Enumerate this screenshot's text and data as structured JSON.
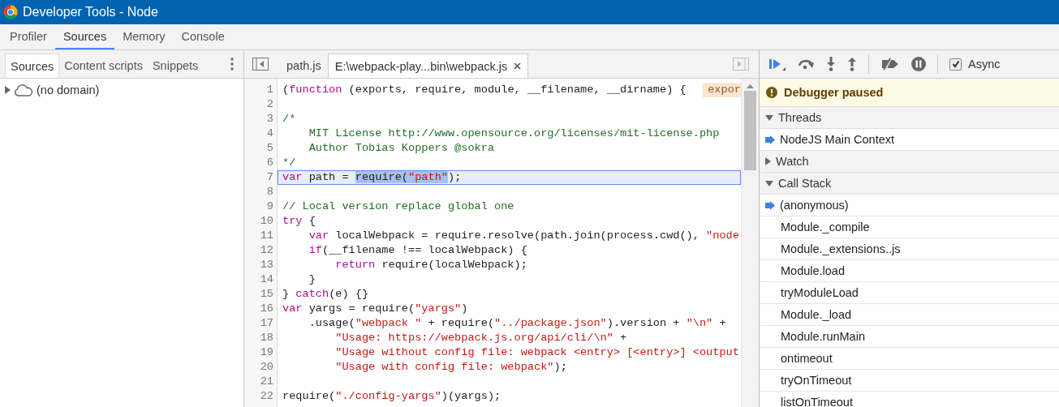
{
  "window": {
    "title": "Developer Tools - Node"
  },
  "main_tabs": [
    {
      "label": "Profiler",
      "selected": false
    },
    {
      "label": "Sources",
      "selected": true
    },
    {
      "label": "Memory",
      "selected": false
    },
    {
      "label": "Console",
      "selected": false
    }
  ],
  "navigator": {
    "tabs": [
      {
        "label": "Sources",
        "selected": true
      },
      {
        "label": "Content scripts",
        "selected": false
      },
      {
        "label": "Snippets",
        "selected": false
      }
    ],
    "tree": [
      {
        "label": "(no domain)",
        "expanded": false
      }
    ]
  },
  "editor": {
    "tabs": [
      {
        "label": "path.js",
        "selected": false,
        "closable": false
      },
      {
        "label": "E:\\webpack-play...bin\\webpack.js",
        "selected": true,
        "closable": true
      }
    ],
    "inline_value": "expor",
    "lines": [
      {
        "number": "1",
        "current": false,
        "tokens": [
          {
            "kind": "plain",
            "text": "("
          },
          {
            "kind": "keyword",
            "text": "function"
          },
          {
            "kind": "plain",
            "text": " (exports, require, module, __filename, __dirname) {"
          }
        ]
      },
      {
        "number": "2",
        "current": false
      },
      {
        "number": "3",
        "current": false,
        "tokens": [
          {
            "kind": "comment",
            "text": "/*"
          }
        ]
      },
      {
        "number": "4",
        "current": false,
        "tokens": [
          {
            "kind": "comment",
            "text": "    MIT License http://www.opensource.org/licenses/mit-license.php"
          }
        ]
      },
      {
        "number": "5",
        "current": false,
        "tokens": [
          {
            "kind": "comment",
            "text": "    Author Tobias Koppers @sokra"
          }
        ]
      },
      {
        "number": "6",
        "current": false,
        "tokens": [
          {
            "kind": "comment",
            "text": "*/"
          }
        ]
      },
      {
        "number": "7",
        "current": true,
        "tokens": [
          {
            "kind": "keyword",
            "text": "var"
          },
          {
            "kind": "plain",
            "text": " path = "
          },
          {
            "kind": "selection",
            "tokens": [
              {
                "kind": "plain",
                "text": "require("
              },
              {
                "kind": "string",
                "text": "\"path\""
              }
            ]
          },
          {
            "kind": "plain",
            "text": ");"
          }
        ]
      },
      {
        "number": "8",
        "current": false
      },
      {
        "number": "9",
        "current": false,
        "tokens": [
          {
            "kind": "comment",
            "text": "// Local version replace global one"
          }
        ]
      },
      {
        "number": "10",
        "current": false,
        "tokens": [
          {
            "kind": "keyword",
            "text": "try"
          },
          {
            "kind": "plain",
            "text": " {"
          }
        ]
      },
      {
        "number": "11",
        "current": false,
        "tokens": [
          {
            "kind": "keyword",
            "text": "    var"
          },
          {
            "kind": "plain",
            "text": " localWebpack = require.resolve(path.join(process.cwd(), "
          },
          {
            "kind": "string",
            "text": "\"node"
          }
        ]
      },
      {
        "number": "12",
        "current": false,
        "tokens": [
          {
            "kind": "keyword",
            "text": "    if"
          },
          {
            "kind": "plain",
            "text": "(__filename !== localWebpack) {"
          }
        ]
      },
      {
        "number": "13",
        "current": false,
        "tokens": [
          {
            "kind": "keyword",
            "text": "        return"
          },
          {
            "kind": "plain",
            "text": " require(localWebpack);"
          }
        ]
      },
      {
        "number": "14",
        "current": false,
        "tokens": [
          {
            "kind": "plain",
            "text": "    }"
          }
        ]
      },
      {
        "number": "15",
        "current": false,
        "tokens": [
          {
            "kind": "plain",
            "text": "} "
          },
          {
            "kind": "keyword",
            "text": "catch"
          },
          {
            "kind": "plain",
            "text": "(e) {}"
          }
        ]
      },
      {
        "number": "16",
        "current": false,
        "tokens": [
          {
            "kind": "keyword",
            "text": "var"
          },
          {
            "kind": "plain",
            "text": " yargs = require("
          },
          {
            "kind": "string",
            "text": "\"yargs\""
          },
          {
            "kind": "plain",
            "text": ")"
          }
        ]
      },
      {
        "number": "17",
        "current": false,
        "tokens": [
          {
            "kind": "plain",
            "text": "    .usage("
          },
          {
            "kind": "string",
            "text": "\"webpack \""
          },
          {
            "kind": "plain",
            "text": " + require("
          },
          {
            "kind": "string",
            "text": "\"../package.json\""
          },
          {
            "kind": "plain",
            "text": ").version + "
          },
          {
            "kind": "string",
            "text": "\"\\n\""
          },
          {
            "kind": "plain",
            "text": " +"
          }
        ]
      },
      {
        "number": "18",
        "current": false,
        "tokens": [
          {
            "kind": "string",
            "text": "        \"Usage: https://webpack.js.org/api/cli/\\n\""
          },
          {
            "kind": "plain",
            "text": " +"
          }
        ]
      },
      {
        "number": "19",
        "current": false,
        "tokens": [
          {
            "kind": "string",
            "text": "        \"Usage without config file: webpack <entry> [<entry>] <output"
          }
        ]
      },
      {
        "number": "20",
        "current": false,
        "tokens": [
          {
            "kind": "string",
            "text": "        \"Usage with config file: webpack\""
          },
          {
            "kind": "plain",
            "text": ");"
          }
        ]
      },
      {
        "number": "21",
        "current": false
      },
      {
        "number": "22",
        "current": false,
        "tokens": [
          {
            "kind": "plain",
            "text": "require("
          },
          {
            "kind": "string",
            "text": "\"./config-yargs\""
          },
          {
            "kind": "plain",
            "text": ")(yargs);"
          }
        ]
      }
    ]
  },
  "debugger": {
    "async": {
      "label": "Async",
      "checked": true
    },
    "banner": "Debugger paused",
    "sections": [
      {
        "title": "Threads",
        "expanded": true,
        "items": [
          {
            "label": "NodeJS Main Context",
            "selected": true
          }
        ]
      },
      {
        "title": "Watch",
        "expanded": false
      },
      {
        "title": "Call Stack",
        "expanded": true,
        "items": [
          {
            "label": "(anonymous)",
            "selected": true
          },
          {
            "label": "Module._compile",
            "selected": false
          },
          {
            "label": "Module._extensions..js",
            "selected": false
          },
          {
            "label": "Module.load",
            "selected": false
          },
          {
            "label": "tryModuleLoad",
            "selected": false
          },
          {
            "label": "Module._load",
            "selected": false
          },
          {
            "label": "Module.runMain",
            "selected": false
          },
          {
            "label": "ontimeout",
            "selected": false
          },
          {
            "label": "tryOnTimeout",
            "selected": false
          },
          {
            "label": "listOnTimeout",
            "selected": false
          }
        ]
      }
    ]
  }
}
